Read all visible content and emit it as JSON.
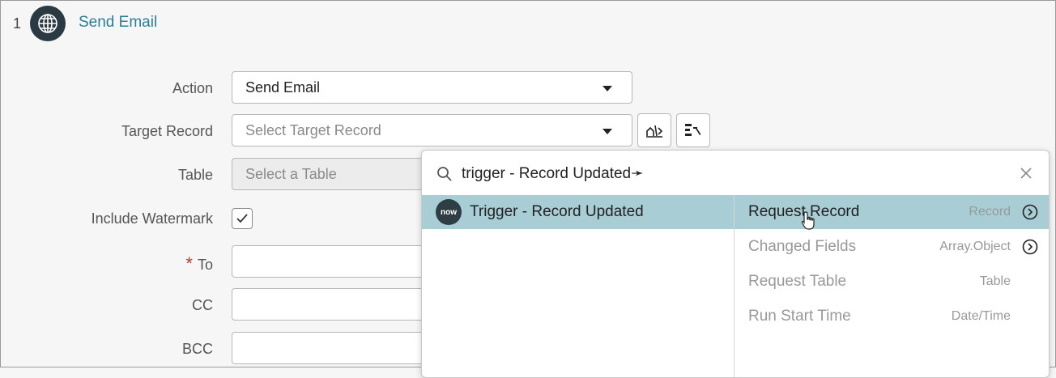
{
  "step": {
    "number": "1",
    "title": "Send Email",
    "icon": "globe-icon"
  },
  "form": {
    "action_label": "Action",
    "action_value": "Send Email",
    "target_record_label": "Target Record",
    "target_record_placeholder": "Select Target Record",
    "table_label": "Table",
    "table_placeholder": "Select a Table",
    "include_watermark_label": "Include Watermark",
    "include_watermark_checked": true,
    "to_label": "To",
    "to_required_mark": "*",
    "cc_label": "CC",
    "bcc_label": "BCC"
  },
  "picker": {
    "search_value": "trigger - Record Updated",
    "search_suffix_glyph": "➛",
    "source_items": [
      {
        "badge": "now",
        "label": "Trigger - Record Updated",
        "selected": true
      }
    ],
    "fields": [
      {
        "name": "Request Record",
        "type": "Record",
        "expandable": true,
        "selected": true
      },
      {
        "name": "Changed Fields",
        "type": "Array.Object",
        "expandable": true,
        "selected": false
      },
      {
        "name": "Request Table",
        "type": "Table",
        "expandable": false,
        "selected": false
      },
      {
        "name": "Run Start Time",
        "type": "Date/Time",
        "expandable": false,
        "selected": false
      }
    ]
  },
  "colors": {
    "accent_link": "#2d7d97",
    "selection_bg": "#a9cdd5",
    "required": "#c0392b",
    "dark_badge": "#2f3d44"
  }
}
